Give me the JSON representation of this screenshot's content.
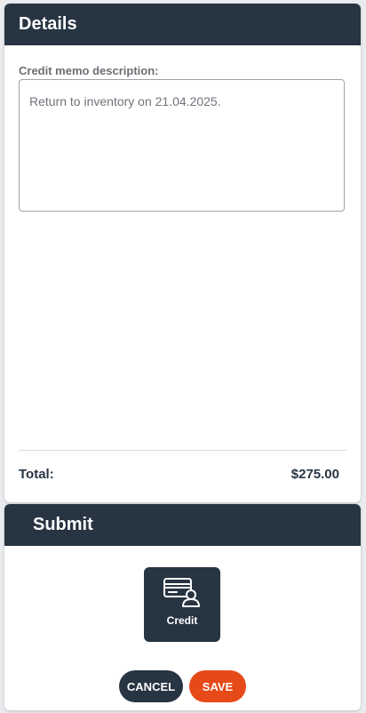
{
  "details": {
    "title": "Details",
    "memo_label": "Credit memo description:",
    "memo_value": "Return to inventory on 21.04.2025.",
    "total_label": "Total:",
    "total_value": "$275.00"
  },
  "submit": {
    "title": "Submit",
    "credit_tile": {
      "label": "Credit",
      "icon": "credit-card-user-icon"
    },
    "cancel_label": "CANCEL",
    "save_label": "SAVE"
  },
  "colors": {
    "header_bg": "#273442",
    "save_accent": "#e64a19",
    "page_bg": "#e9ebee"
  }
}
